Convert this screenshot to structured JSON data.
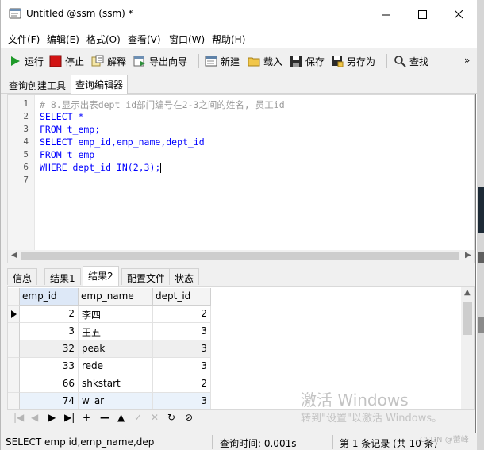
{
  "window": {
    "title": "Untitled @ssm (ssm) *"
  },
  "menu": [
    "文件(F)",
    "编辑(E)",
    "格式(O)",
    "查看(V)",
    "窗口(W)",
    "帮助(H)"
  ],
  "toolbar": {
    "run": "运行",
    "stop": "停止",
    "explain": "解释",
    "export_wizard": "导出向导",
    "new": "新建",
    "load": "载入",
    "save": "保存",
    "save_as": "另存为",
    "find": "查找",
    "more": "»"
  },
  "top_tabs": [
    "查询创建工具",
    "查询编辑器"
  ],
  "editor": {
    "line_numbers": [
      "1",
      "2",
      "3",
      "4",
      "5",
      "6",
      "7"
    ],
    "lines": [
      "# 8.显示出表dept_id部门编号在2-3之间的姓名, 员工id",
      "SELECT *",
      "FROM t_emp;",
      "SELECT emp_id,emp_name,dept_id",
      "FROM t_emp",
      "WHERE dept_id IN(2,3);",
      ""
    ]
  },
  "result_tabs": [
    "信息",
    "结果1",
    "结果2",
    "配置文件",
    "状态"
  ],
  "grid": {
    "columns": [
      "emp_id",
      "emp_name",
      "dept_id"
    ],
    "rows": [
      [
        "2",
        "李四",
        "2"
      ],
      [
        "3",
        "王五",
        "3"
      ],
      [
        "32",
        "peak",
        "3"
      ],
      [
        "33",
        "rede",
        "3"
      ],
      [
        "66",
        "shkstart",
        "2"
      ],
      [
        "74",
        "w_ar",
        "3"
      ]
    ]
  },
  "watermark": {
    "line1": "激活 Windows",
    "line2": "转到\"设置\"以激活 Windows。"
  },
  "status": {
    "sql": "SELECT emp id,emp_name,dep",
    "query_time": "查询时间: 0.001s",
    "record": "第 1 条记录 (共 10 条)"
  },
  "csdn": "CSDN @蕾峰"
}
